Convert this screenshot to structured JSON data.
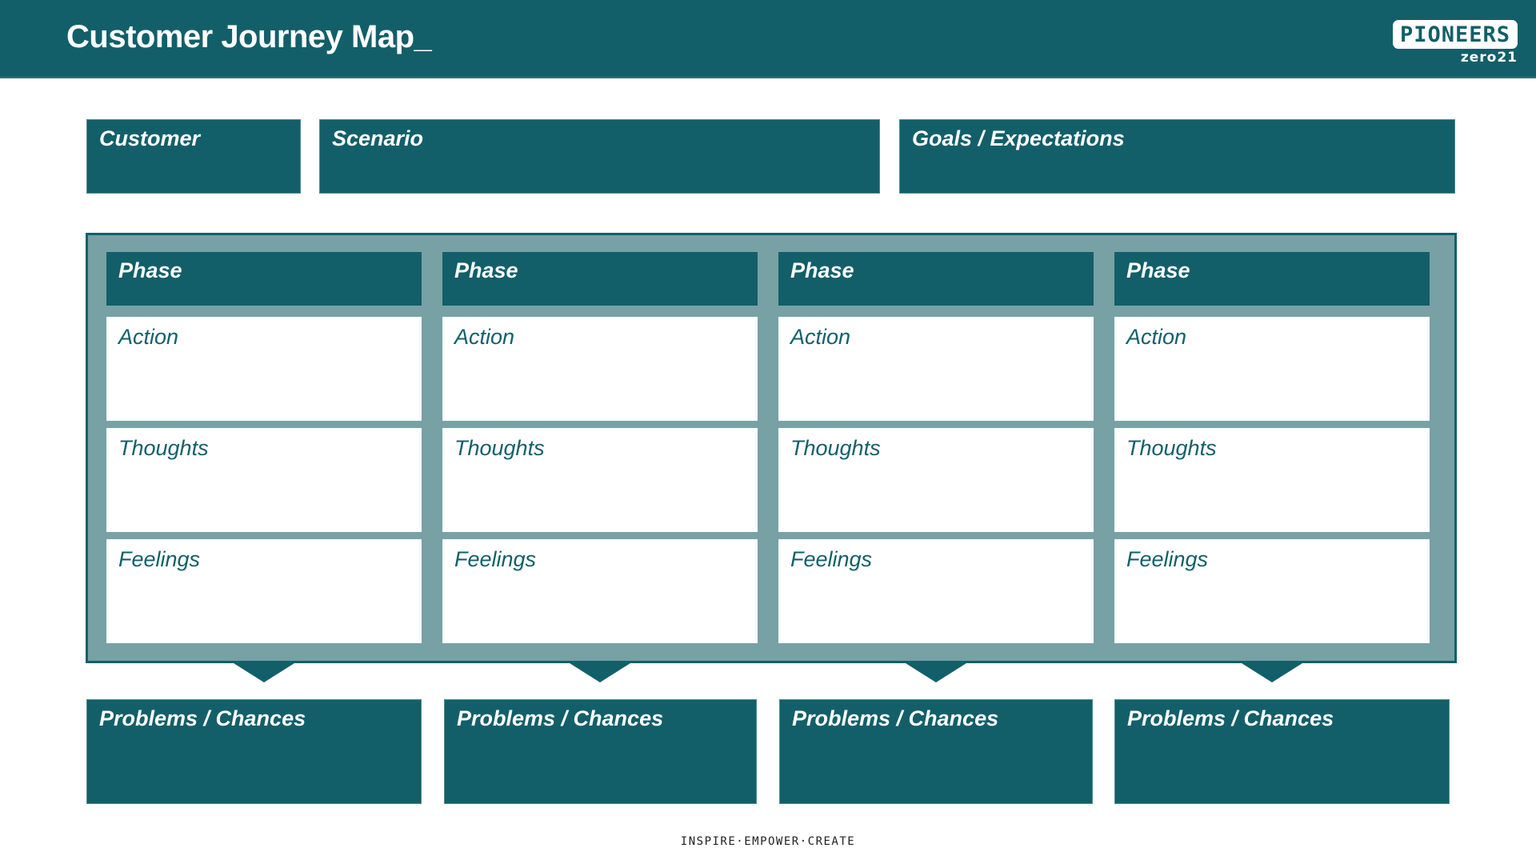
{
  "header": {
    "title": "Customer Journey Map_",
    "logo": {
      "name": "PIONEERS",
      "sub": "zero21"
    }
  },
  "colors": {
    "primary": "#135f69",
    "frame_fill": "#77a1a4",
    "background": "#ffffff",
    "cell_text": "#135f69"
  },
  "info_boxes": [
    {
      "label": "Customer"
    },
    {
      "label": "Scenario"
    },
    {
      "label": "Goals / Expectations"
    }
  ],
  "columns": [
    {
      "phase": "Phase",
      "action": "Action",
      "thoughts": "Thoughts",
      "feelings": "Feelings",
      "problems": "Problems / Chances"
    },
    {
      "phase": "Phase",
      "action": "Action",
      "thoughts": "Thoughts",
      "feelings": "Feelings",
      "problems": "Problems / Chances"
    },
    {
      "phase": "Phase",
      "action": "Action",
      "thoughts": "Thoughts",
      "feelings": "Feelings",
      "problems": "Problems / Chances"
    },
    {
      "phase": "Phase",
      "action": "Action",
      "thoughts": "Thoughts",
      "feelings": "Feelings",
      "problems": "Problems / Chances"
    }
  ],
  "footer": {
    "tagline": "inspire·empower·create"
  }
}
